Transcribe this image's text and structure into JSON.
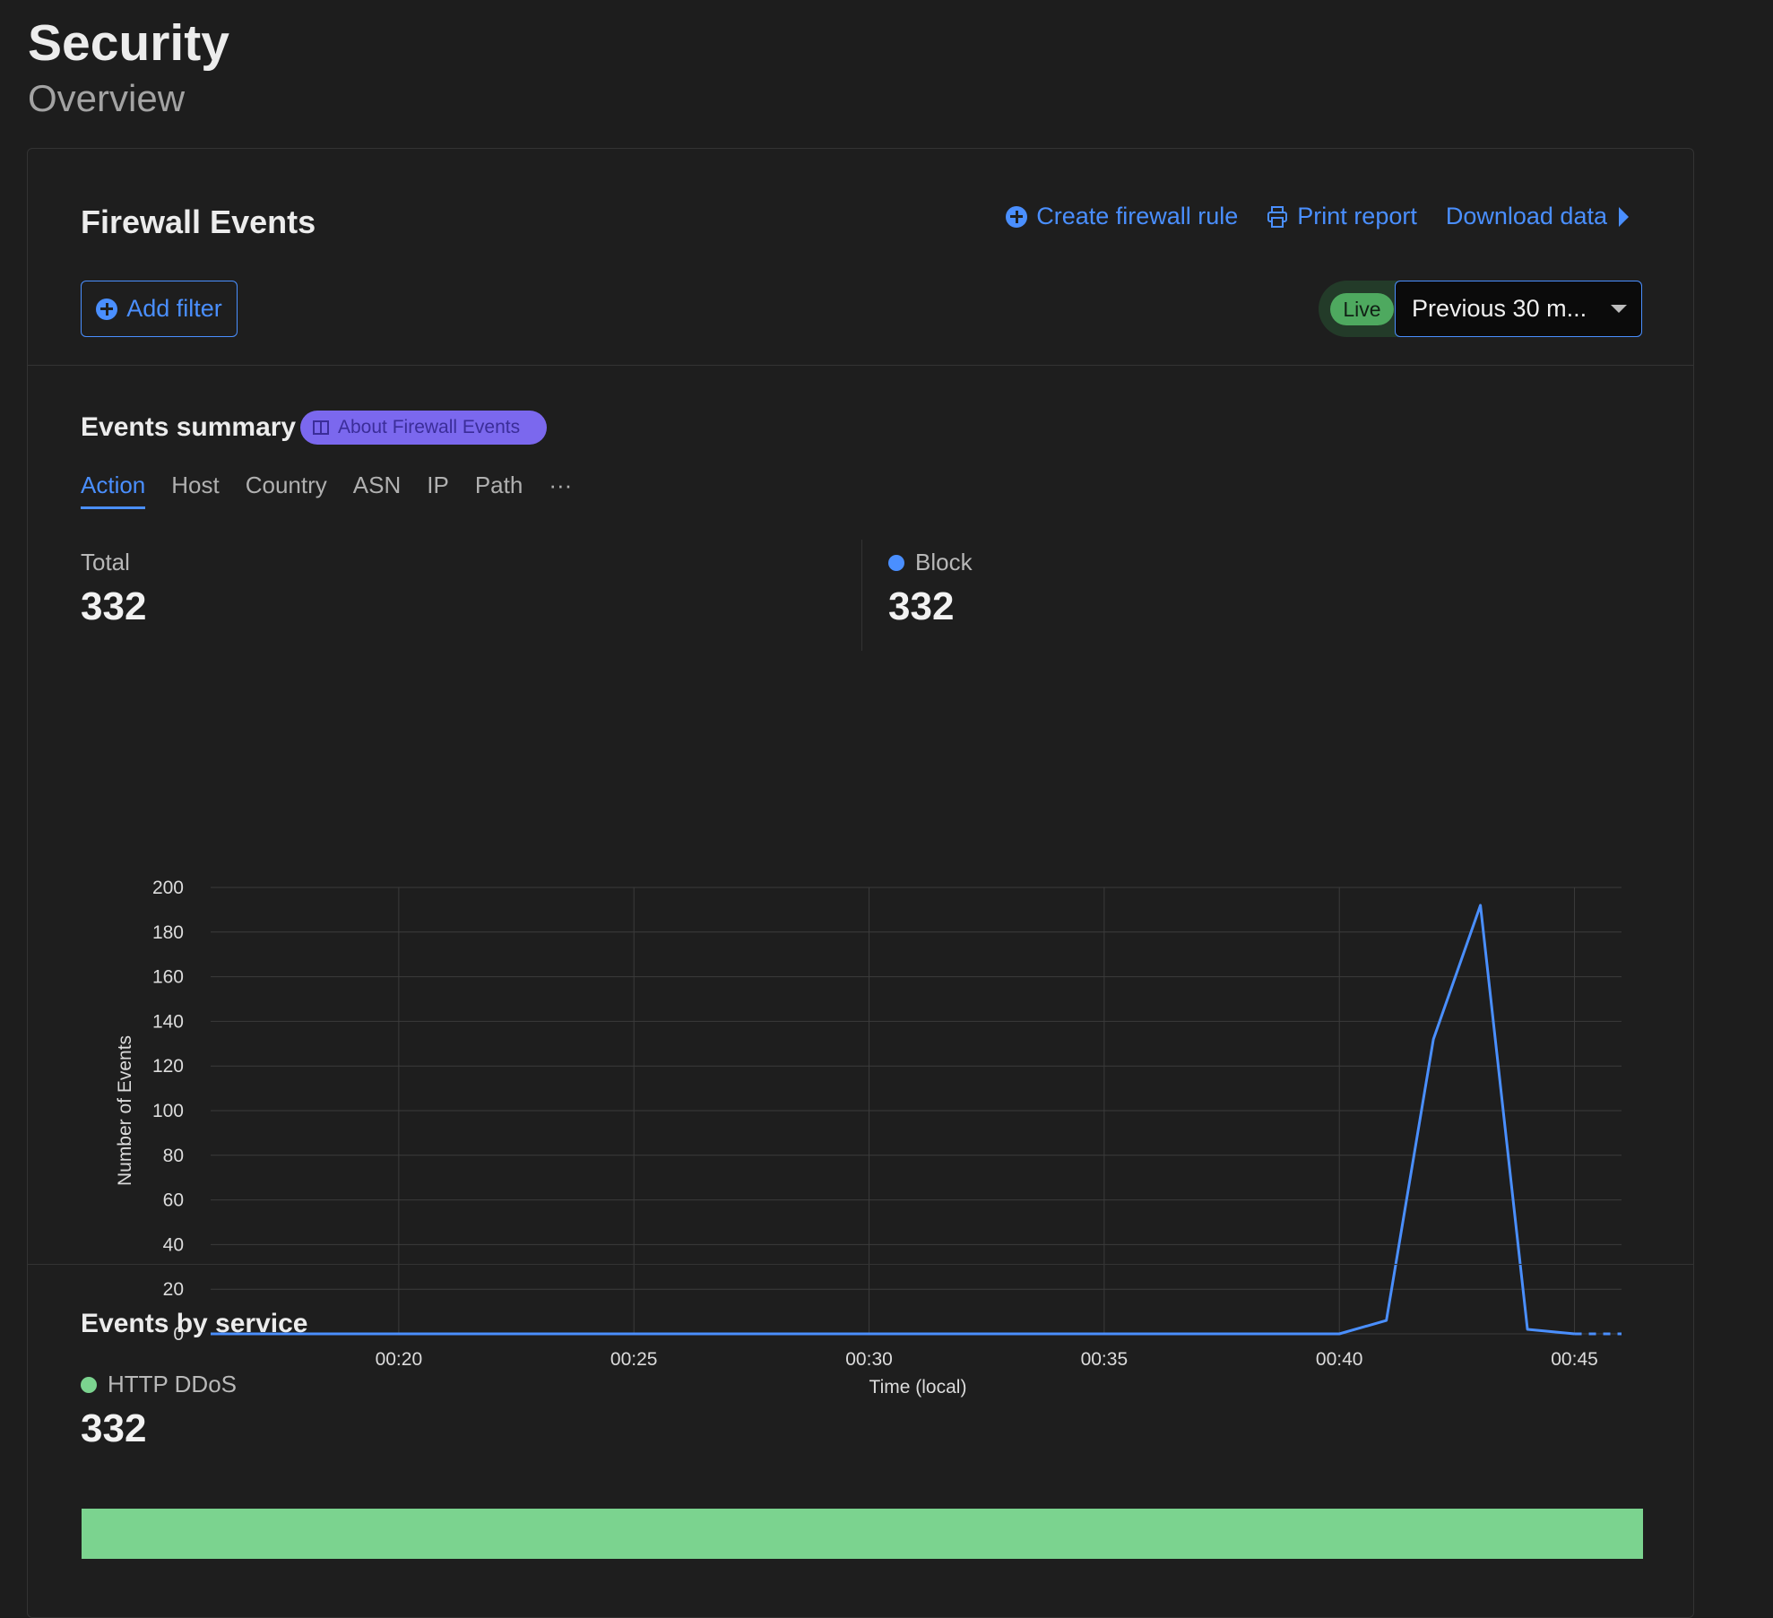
{
  "header": {
    "title": "Security",
    "subtitle": "Overview"
  },
  "firewall": {
    "title": "Firewall Events",
    "actions": {
      "create_rule": "Create firewall rule",
      "print": "Print report",
      "download": "Download data"
    },
    "add_filter": "Add filter",
    "live": "Live",
    "time_range": "Previous 30 m..."
  },
  "summary": {
    "title": "Events summary",
    "about": "About Firewall Events",
    "tabs": [
      "Action",
      "Host",
      "Country",
      "ASN",
      "IP",
      "Path",
      "···"
    ],
    "active_tab": "Action",
    "total_label": "Total",
    "total_value": "332",
    "block_label": "Block",
    "block_value": "332",
    "block_color": "#4a8fff"
  },
  "chart_data": {
    "type": "line",
    "title": "",
    "xlabel": "Time (local)",
    "ylabel": "Number of Events",
    "ylim": [
      0,
      200
    ],
    "yticks": [
      "0",
      "20",
      "40",
      "60",
      "80",
      "100",
      "120",
      "140",
      "160",
      "180",
      "200"
    ],
    "xticks": [
      "00:20",
      "00:25",
      "00:30",
      "00:35",
      "00:40",
      "00:45"
    ],
    "grid": true,
    "series": [
      {
        "name": "Block",
        "color": "#4a8fff",
        "x": [
          "00:16",
          "00:17",
          "00:18",
          "00:19",
          "00:20",
          "00:21",
          "00:22",
          "00:23",
          "00:24",
          "00:25",
          "00:26",
          "00:27",
          "00:28",
          "00:29",
          "00:30",
          "00:31",
          "00:32",
          "00:33",
          "00:34",
          "00:35",
          "00:36",
          "00:37",
          "00:38",
          "00:39",
          "00:40",
          "00:41",
          "00:42",
          "00:43",
          "00:44",
          "00:45",
          "00:46"
        ],
        "y": [
          0,
          0,
          0,
          0,
          0,
          0,
          0,
          0,
          0,
          0,
          0,
          0,
          0,
          0,
          0,
          0,
          0,
          0,
          0,
          0,
          0,
          0,
          0,
          0,
          0,
          6,
          132,
          192,
          2,
          0,
          0
        ],
        "dashed_from": "00:45"
      }
    ]
  },
  "service": {
    "title": "Events by service",
    "label": "HTTP DDoS",
    "value": "332",
    "color": "#7bd38f",
    "share": 1.0
  }
}
